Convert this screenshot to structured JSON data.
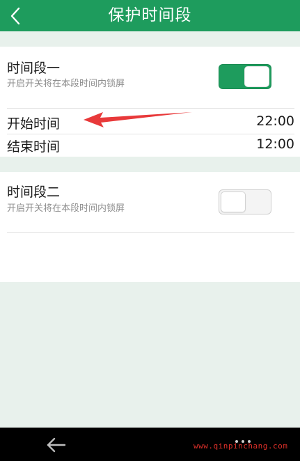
{
  "header": {
    "title": "保护时间段"
  },
  "period1": {
    "title": "时间段一",
    "subtitle": "开启开关将在本段时间内锁屏",
    "enabled": true,
    "start_label": "开始时间",
    "start_value": "22:00",
    "end_label": "结束时间",
    "end_value": "12:00"
  },
  "period2": {
    "title": "时间段二",
    "subtitle": "开启开关将在本段时间内锁屏",
    "enabled": false
  },
  "watermark": "www.qinpinchang.com",
  "colors": {
    "accent": "#1e9c5d",
    "annotation": "#e8393a"
  }
}
